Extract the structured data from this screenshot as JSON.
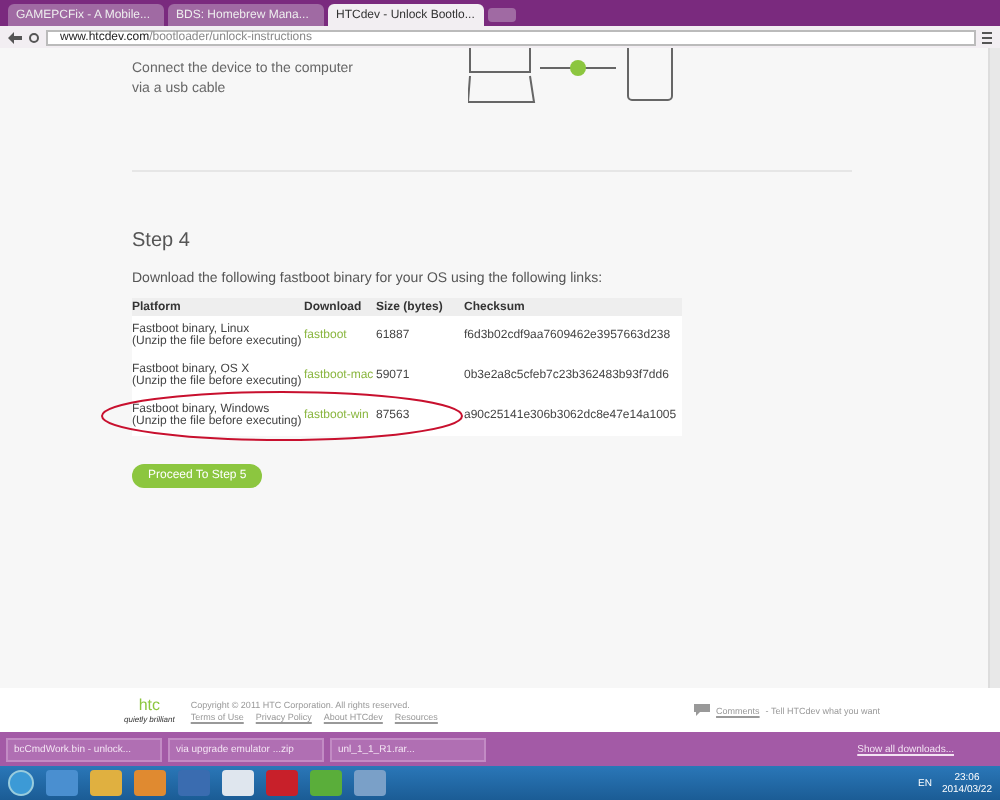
{
  "browser": {
    "tabs": [
      {
        "title": "GAMEPCFix - A Mobile...",
        "selected": false
      },
      {
        "title": "BDS: Homebrew Mana...",
        "selected": false
      },
      {
        "title": "HTCdev - Unlock Bootlo...",
        "selected": true
      }
    ],
    "url_host": "www.htcdev.com",
    "url_path": "/bootloader/unlock-instructions"
  },
  "step3": {
    "text": "Connect the device to the computer via a usb cable"
  },
  "step4": {
    "title": "Step 4",
    "intro": "Download the following fastboot binary for your OS using the following links:",
    "columns": [
      "Platform",
      "Download",
      "Size (bytes)",
      "Checksum"
    ],
    "rows": [
      {
        "platform": "Fastboot binary, Linux",
        "note": "(Unzip the file before executing)",
        "link": "fastboot",
        "size": "61887",
        "checksum": "f6d3b02cdf9aa7609462e3957663d238",
        "annotated": false
      },
      {
        "platform": "Fastboot binary, OS X",
        "note": "(Unzip the file before executing)",
        "link": "fastboot-mac",
        "size": "59071",
        "checksum": "0b3e2a8c5cfeb7c23b362483b93f7dd6",
        "annotated": false
      },
      {
        "platform": "Fastboot binary, Windows",
        "note": "(Unzip the file before executing)",
        "link": "fastboot-win",
        "size": "87563",
        "checksum": "a90c25141e306b3062dc8e47e14a1005",
        "annotated": true
      }
    ],
    "button": "Proceed To Step 5"
  },
  "footer": {
    "logo": "htc",
    "tagline": "quietly brilliant",
    "copyright": "Copyright © 2011 HTC Corporation. All rights reserved.",
    "links": [
      "Terms of Use",
      "Privacy Policy",
      "About HTCdev",
      "Resources"
    ],
    "comments_link": "Comments",
    "comments_text": "- Tell HTCdev what you want"
  },
  "downloads": {
    "items": [
      "bcCmdWork.bin - unlock...",
      "via upgrade emulator ...zip",
      "unl_1_1_R1.rar..."
    ],
    "show_all": "Show all downloads..."
  },
  "taskbar": {
    "lang": "EN",
    "time": "23:06",
    "date": "2014/03/22"
  }
}
